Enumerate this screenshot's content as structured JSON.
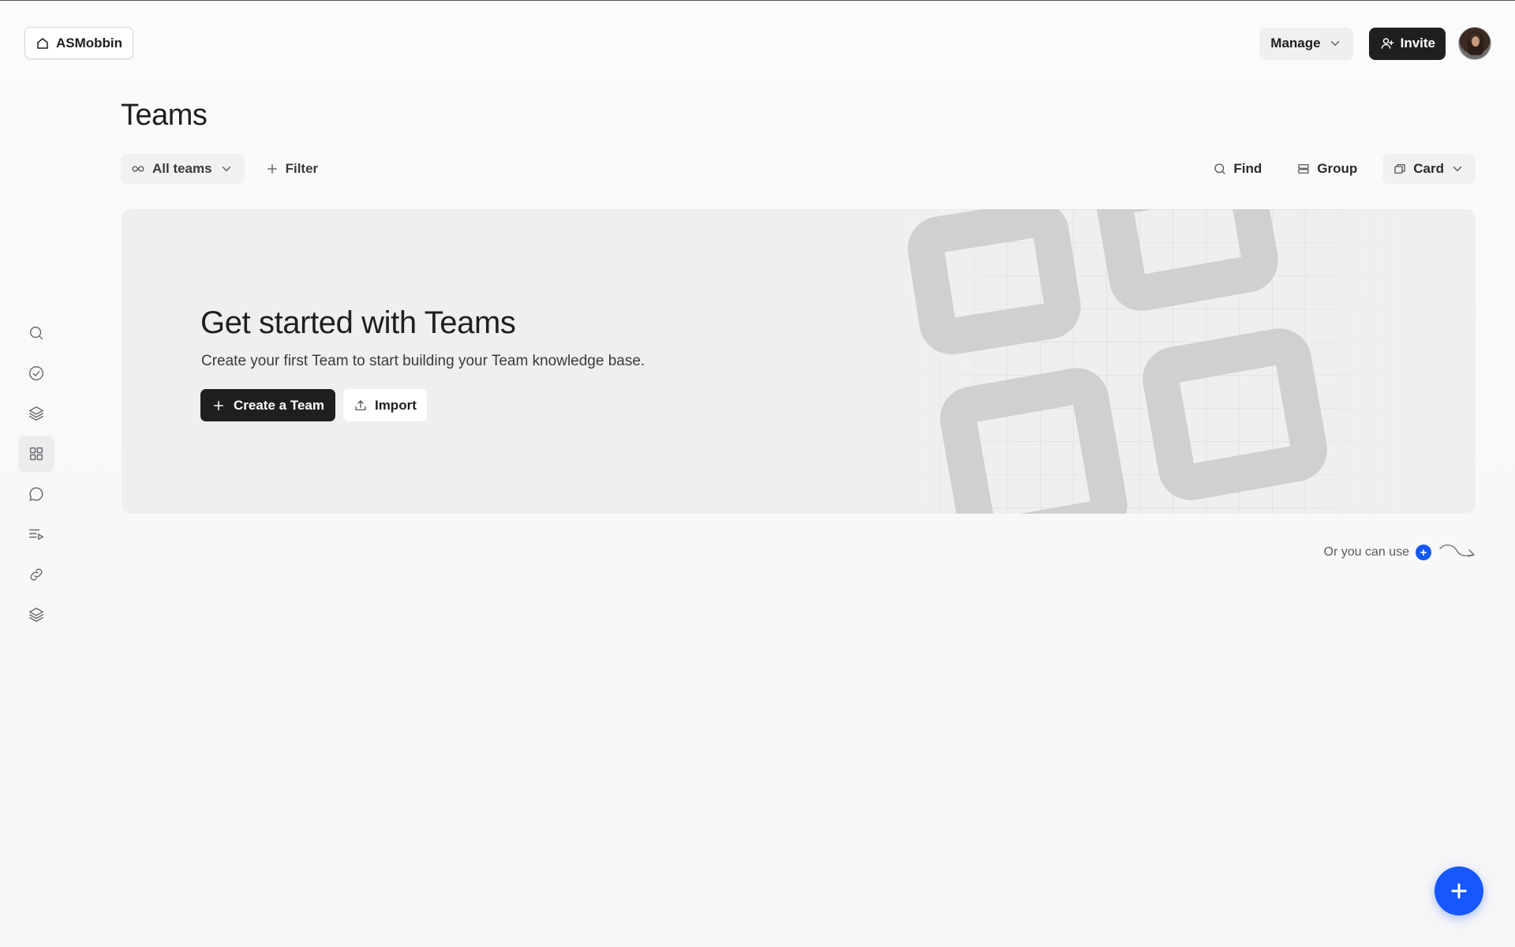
{
  "header": {
    "workspace_name": "ASMobbin",
    "manage_label": "Manage",
    "invite_label": "Invite"
  },
  "page": {
    "title": "Teams"
  },
  "toolbar": {
    "scope_label": "All teams",
    "filter_label": "Filter",
    "find_label": "Find",
    "group_label": "Group",
    "view_label": "Card"
  },
  "banner": {
    "title": "Get started with Teams",
    "subtitle": "Create your first Team to start building your Team knowledge base.",
    "create_label": "Create a Team",
    "import_label": "Import"
  },
  "hint": {
    "text": "Or you can use",
    "dot": "+"
  },
  "sidebar": {
    "items": [
      {
        "icon": "search-icon"
      },
      {
        "icon": "check-circle-icon"
      },
      {
        "icon": "layers-icon"
      },
      {
        "icon": "grid-icon",
        "active": true
      },
      {
        "icon": "chat-icon"
      },
      {
        "icon": "playlist-icon"
      },
      {
        "icon": "link-icon"
      },
      {
        "icon": "stack-icon"
      }
    ]
  },
  "colors": {
    "accent": "#1657ff",
    "dark": "#1f1f21",
    "banner_bg": "#efeff0"
  }
}
